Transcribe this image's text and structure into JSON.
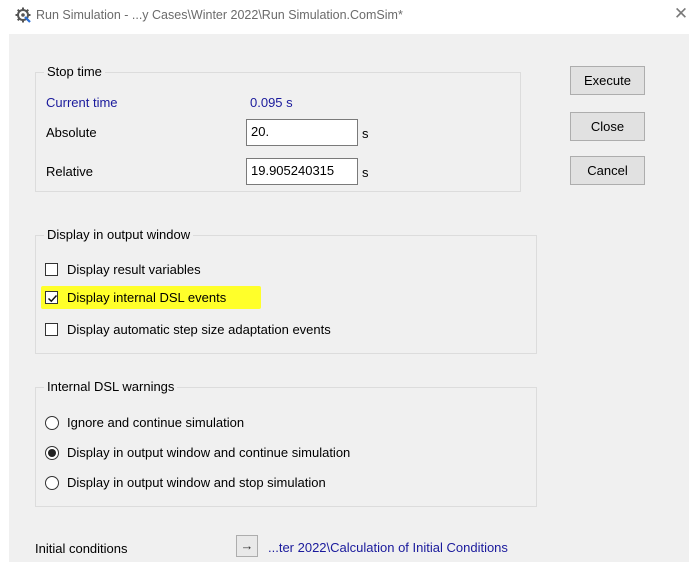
{
  "window": {
    "title": "Run Simulation - ...y Cases\\Winter 2022\\Run Simulation.ComSim*",
    "close_glyph": "✕"
  },
  "stop_time": {
    "legend": "Stop time",
    "current_time_label": "Current time",
    "current_time_value": "0.095 s",
    "absolute_label": "Absolute",
    "absolute_value": "20.",
    "absolute_unit": "s",
    "relative_label": "Relative",
    "relative_value": "19.905240315",
    "relative_unit": "s"
  },
  "buttons": {
    "execute": "Execute",
    "close": "Close",
    "cancel": "Cancel"
  },
  "display_output": {
    "legend": "Display in output window",
    "options": [
      {
        "label": "Display result variables",
        "checked": false
      },
      {
        "label": "Display internal DSL events",
        "checked": true,
        "highlighted": true
      },
      {
        "label": "Display automatic step size adaptation events",
        "checked": false
      }
    ]
  },
  "dsl_warnings": {
    "legend": "Internal DSL warnings",
    "options": [
      {
        "label": "Ignore and continue simulation",
        "selected": false
      },
      {
        "label": "Display in output window and continue simulation",
        "selected": true
      },
      {
        "label": "Display in output window and stop simulation",
        "selected": false
      }
    ]
  },
  "initial_conditions": {
    "label": "Initial conditions",
    "arrow_glyph": "→",
    "link": "...ter 2022\\Calculation of Initial Conditions"
  },
  "colors": {
    "highlight": "#ffff2a",
    "link_blue": "#1a1a9c",
    "dialog_bg": "#f0f0f0"
  }
}
